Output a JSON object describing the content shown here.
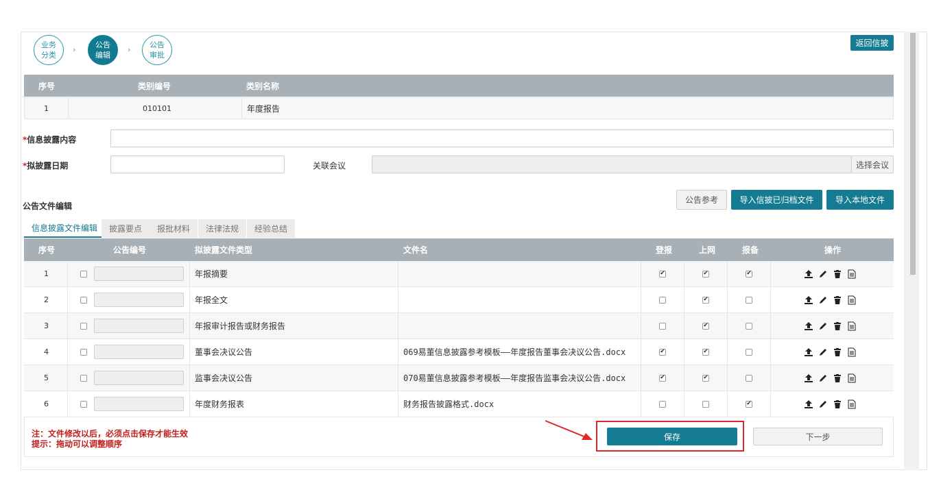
{
  "steps": [
    {
      "label": "业务分类",
      "active": false
    },
    {
      "label": "公告编辑",
      "active": true
    },
    {
      "label": "公告审批",
      "active": false
    }
  ],
  "back_button": "返回信披",
  "category_table": {
    "headers": [
      "序号",
      "类别编号",
      "类别名称"
    ],
    "row": {
      "seq": "1",
      "code": "010101",
      "name": "年度报告"
    }
  },
  "form": {
    "content_label": "信息披露内容",
    "content_value": "",
    "date_label": "拟披露日期",
    "date_value": "",
    "meeting_label": "关联会议",
    "meeting_value": "",
    "meeting_button": "选择会议",
    "required_mark": "*"
  },
  "section_title": "公告文件编辑",
  "actions": {
    "reference": "公告参考",
    "import_archived": "导入信披已归档文件",
    "import_local": "导入本地文件"
  },
  "tabs": [
    {
      "label": "信息披露文件编辑",
      "active": true
    },
    {
      "label": "披露要点",
      "active": false
    },
    {
      "label": "报批材料",
      "active": false
    },
    {
      "label": "法律法规",
      "active": false
    },
    {
      "label": "经验总结",
      "active": false
    }
  ],
  "file_table": {
    "headers": [
      "序号",
      "公告编号",
      "拟披露文件类型",
      "文件名",
      "登报",
      "上网",
      "报备",
      "操作"
    ],
    "rows": [
      {
        "seq": "1",
        "type": "年报摘要",
        "filename": "",
        "newspaper": true,
        "online": true,
        "filing": true
      },
      {
        "seq": "2",
        "type": "年报全文",
        "filename": "",
        "newspaper": false,
        "online": true,
        "filing": false
      },
      {
        "seq": "3",
        "type": "年报审计报告或财务报告",
        "filename": "",
        "newspaper": false,
        "online": true,
        "filing": false
      },
      {
        "seq": "4",
        "type": "董事会决议公告",
        "filename": "069易董信息披露参考模板——年度报告董事会决议公告.docx",
        "newspaper": true,
        "online": true,
        "filing": false
      },
      {
        "seq": "5",
        "type": "监事会决议公告",
        "filename": "070易董信息披露参考模板——年度报告监事会决议公告.docx",
        "newspaper": true,
        "online": true,
        "filing": false
      },
      {
        "seq": "6",
        "type": "年度财务报表",
        "filename": "财务报告披露格式.docx",
        "newspaper": false,
        "online": false,
        "filing": true
      }
    ],
    "op_icons": [
      "upload-icon",
      "edit-icon",
      "delete-icon",
      "document-icon"
    ]
  },
  "notes": {
    "line1": "注：文件修改以后，必须点击保存才能生效",
    "line2": "提示：拖动可以调整顺序"
  },
  "footer": {
    "save": "保存",
    "next": "下一步"
  },
  "colors": {
    "primary": "#147b93",
    "header_bg": "#a7b0b6",
    "note_red": "#c0201c",
    "annotation_red": "#e02626"
  }
}
